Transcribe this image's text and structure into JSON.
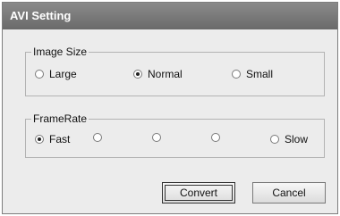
{
  "window": {
    "title": "AVI Setting"
  },
  "image_size": {
    "label": "Image Size",
    "options": [
      {
        "label": "Large",
        "checked": false
      },
      {
        "label": "Normal",
        "checked": true
      },
      {
        "label": "Small",
        "checked": false
      }
    ]
  },
  "frame_rate": {
    "label": "FrameRate",
    "options": [
      {
        "label": "Fast",
        "checked": true
      },
      {
        "label": "",
        "checked": false
      },
      {
        "label": "",
        "checked": false
      },
      {
        "label": "",
        "checked": false
      },
      {
        "label": "Slow",
        "checked": false
      }
    ]
  },
  "buttons": {
    "convert": "Convert",
    "cancel": "Cancel"
  }
}
